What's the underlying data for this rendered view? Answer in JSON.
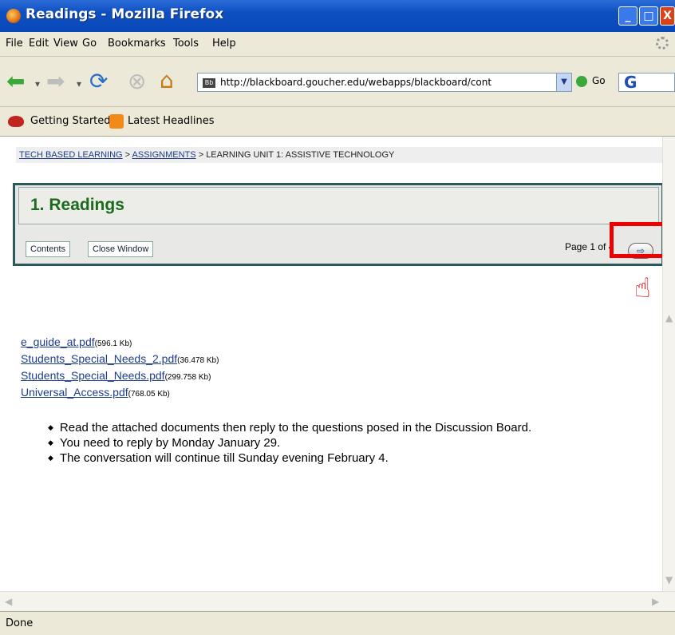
{
  "window": {
    "title": "Readings - Mozilla Firefox",
    "min": "_",
    "max": "□",
    "close": "X"
  },
  "menu": {
    "items": [
      "File",
      "Edit",
      "View",
      "Go",
      "Bookmarks",
      "Tools",
      "Help"
    ]
  },
  "nav": {
    "url": "http://blackboard.goucher.edu/webapps/blackboard/cont",
    "go_label": "Go",
    "search_engine": "G"
  },
  "bookmarks": {
    "items": [
      "Getting Started",
      "Latest Headlines"
    ]
  },
  "breadcrumb": {
    "items": [
      "TECH BASED LEARNING",
      "ASSIGNMENTS",
      "LEARNING UNIT 1: ASSISTIVE TECHNOLOGY"
    ],
    "separator": ">"
  },
  "panel": {
    "title": "1. Readings",
    "contents_label": "Contents",
    "close_label": "Close Window",
    "page_info": "Page 1 of 4"
  },
  "files": [
    {
      "name": "e_guide_at.pdf",
      "size": "(596.1 Kb)"
    },
    {
      "name": "Students_Special_Needs_2.pdf",
      "size": "(36.478 Kb)"
    },
    {
      "name": "Students_Special_Needs.pdf",
      "size": "(299.758 Kb)"
    },
    {
      "name": "Universal_Access.pdf",
      "size": "(768.05 Kb)"
    }
  ],
  "instructions": [
    "Read the attached documents then reply to the questions posed in the Discussion Board.",
    "You need to reply by Monday January 29.",
    "The conversation will continue till Sunday evening February 4."
  ],
  "status": {
    "text": "Done"
  },
  "colors": {
    "titlebar": "#0a48b8",
    "panel_border": "#2c5a5a",
    "heading_green": "#1c6b1c",
    "highlight": "#e00000"
  }
}
